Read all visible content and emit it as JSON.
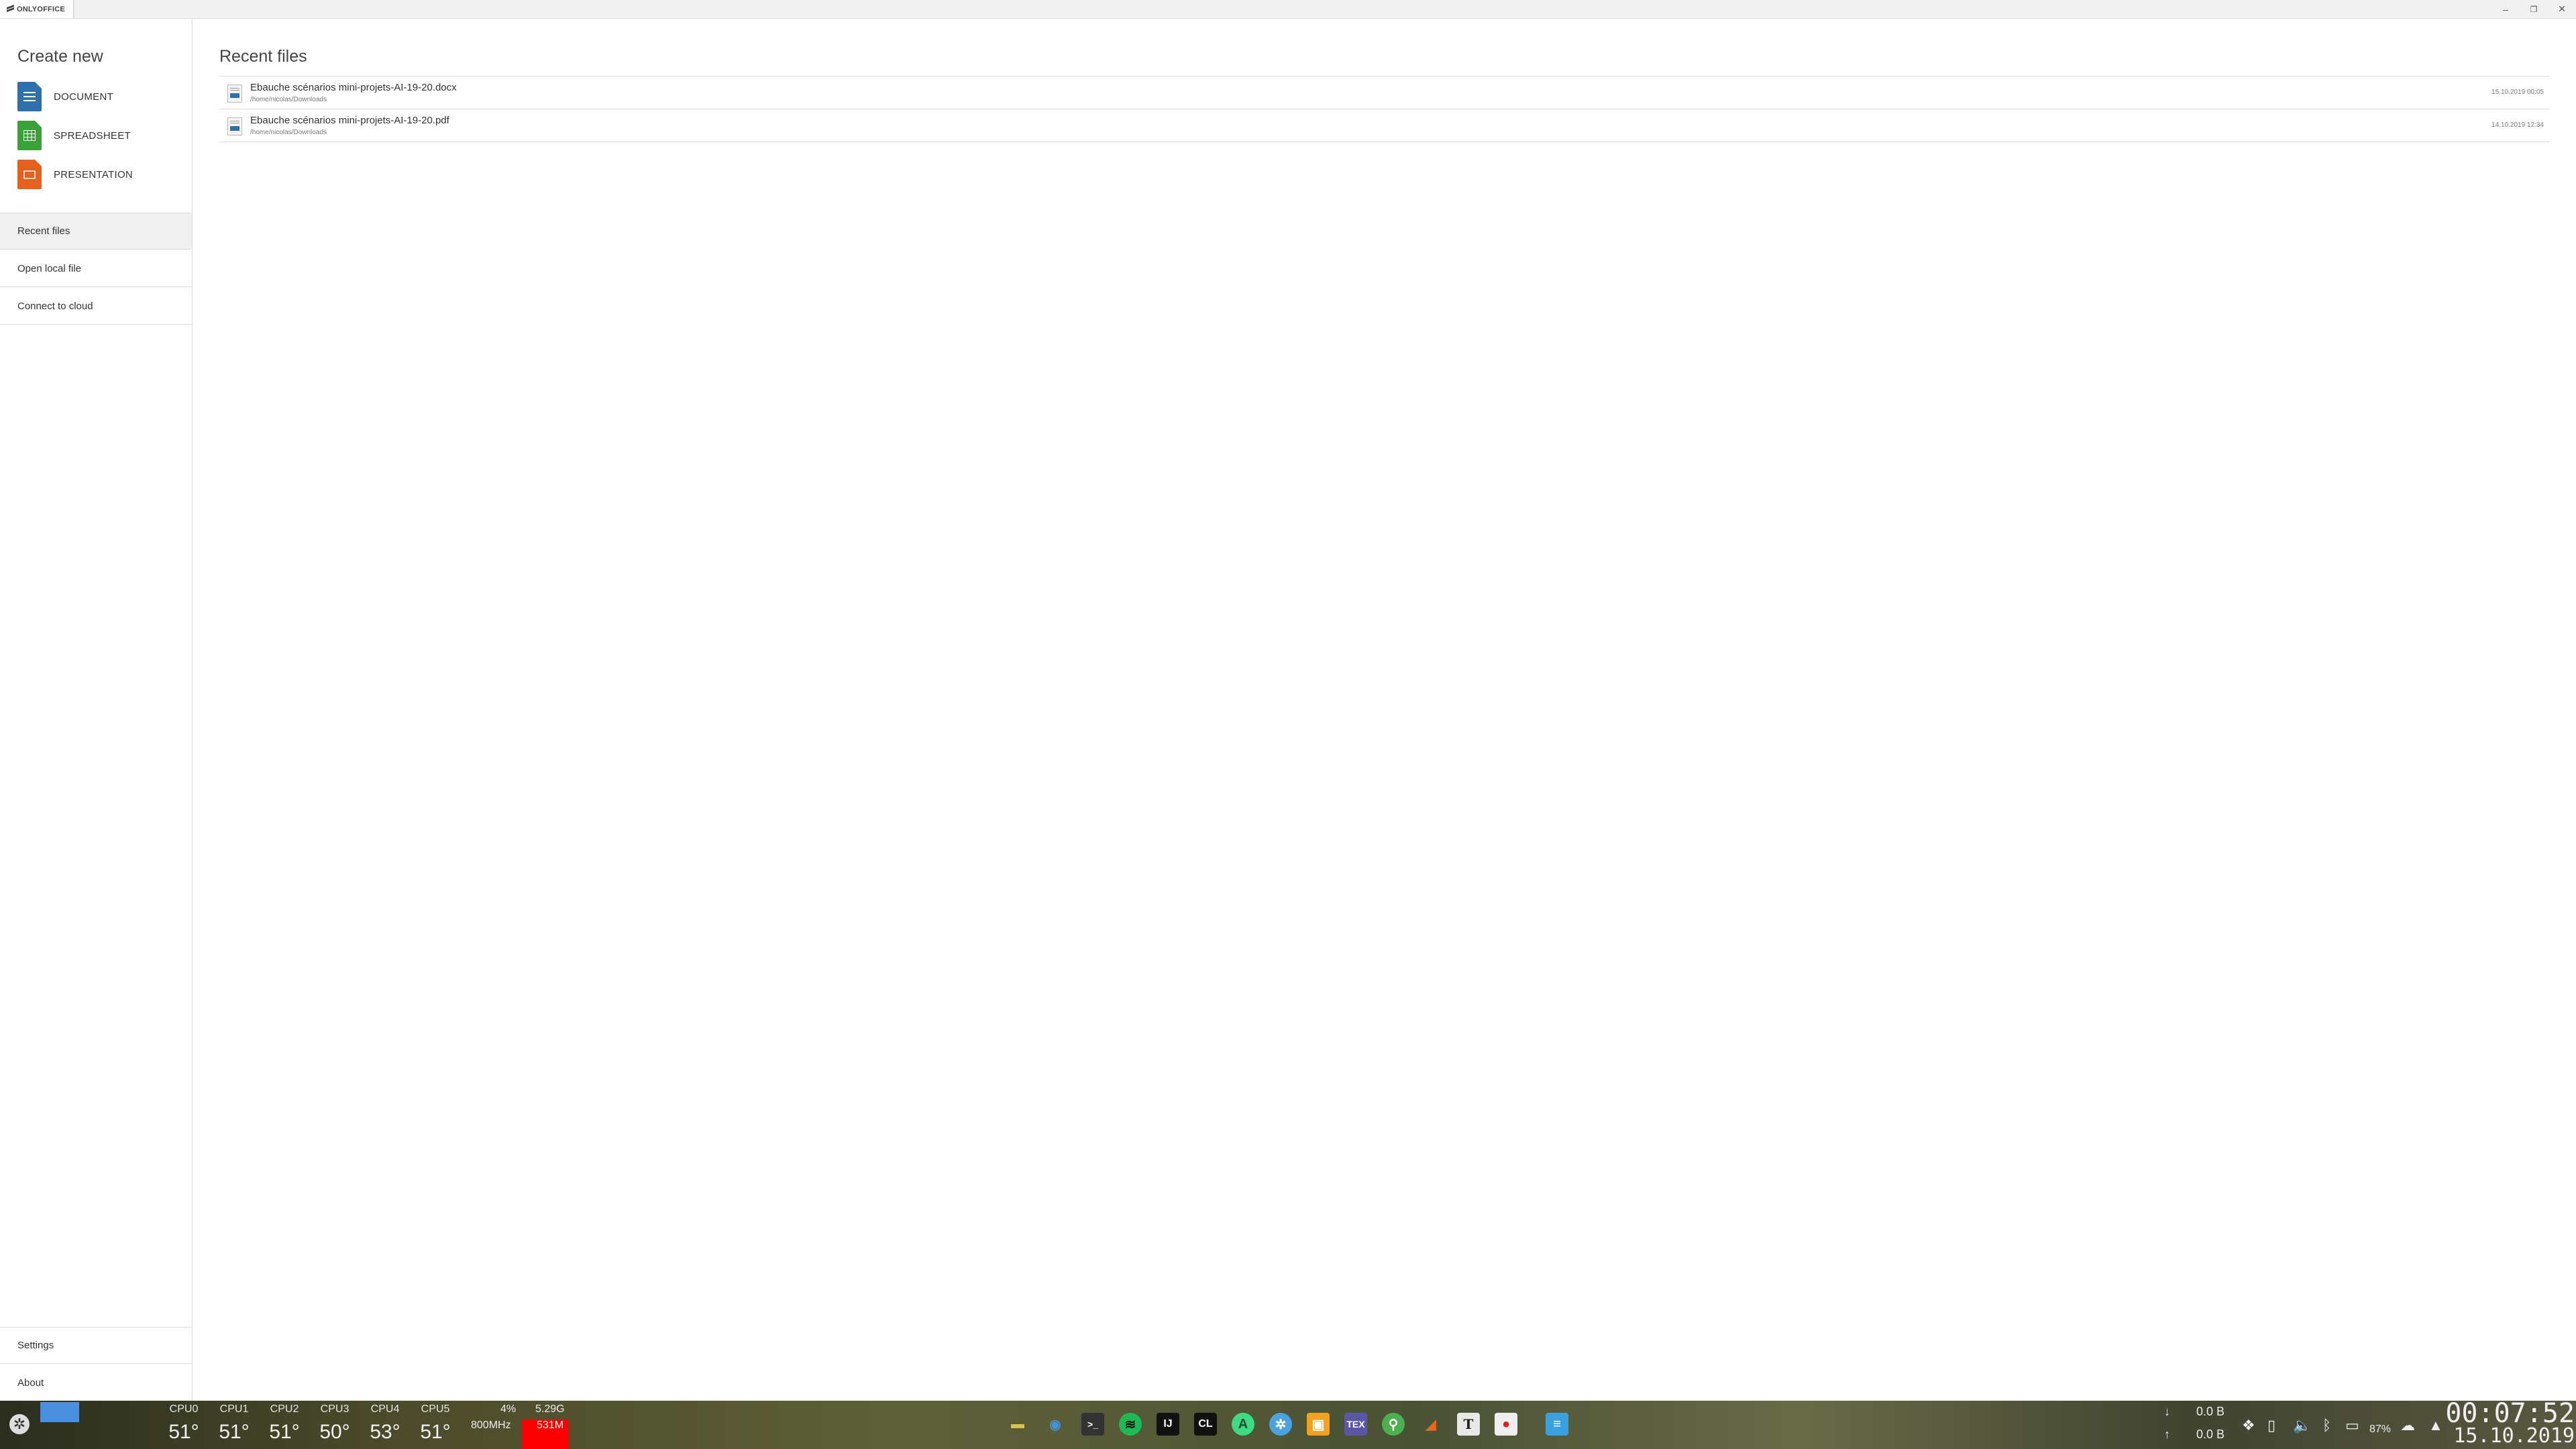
{
  "titlebar": {
    "app_name": "ONLYOFFICE",
    "minimize": "–",
    "restore": "❐",
    "close": "✕"
  },
  "sidebar": {
    "create_title": "Create new",
    "create_items": [
      {
        "label": "DOCUMENT",
        "color": "#2f6fae",
        "icon": "document-icon"
      },
      {
        "label": "SPREADSHEET",
        "color": "#3aa13a",
        "icon": "spreadsheet-icon"
      },
      {
        "label": "PRESENTATION",
        "color": "#e5611d",
        "icon": "presentation-icon"
      }
    ],
    "nav": [
      {
        "label": "Recent files",
        "active": true
      },
      {
        "label": "Open local file"
      },
      {
        "label": "Connect to cloud"
      }
    ],
    "bottom": [
      {
        "label": "Settings"
      },
      {
        "label": "About"
      }
    ]
  },
  "main": {
    "title": "Recent files",
    "files": [
      {
        "name": "Ebauche scénarios mini-projets-AI-19-20.docx",
        "path": "/home/nicolas/Downloads",
        "date": "15.10.2019 00:05"
      },
      {
        "name": "Ebauche scénarios mini-projets-AI-19-20.pdf",
        "path": "/home/nicolas/Downloads",
        "date": "14.10.2019 12:34"
      }
    ]
  },
  "taskbar": {
    "cpus": [
      {
        "name": "CPU0",
        "temp": "51°"
      },
      {
        "name": "CPU1",
        "temp": "51°"
      },
      {
        "name": "CPU2",
        "temp": "51°"
      },
      {
        "name": "CPU3",
        "temp": "50°"
      },
      {
        "name": "CPU4",
        "temp": "53°"
      },
      {
        "name": "CPU5",
        "temp": "51°"
      }
    ],
    "cpu_load": "4%",
    "cpu_freq": "800MHz",
    "mem_total": "5.29G",
    "mem_used": "531M",
    "apps": [
      {
        "icon": "file-manager-icon",
        "glyph": "▬",
        "color": "#d9c350"
      },
      {
        "icon": "chrome-icon",
        "glyph": "◉",
        "color": "#4a90d9"
      },
      {
        "icon": "terminal-icon",
        "glyph": ">_",
        "color": "#333333"
      },
      {
        "icon": "spotify-icon",
        "glyph": "≋",
        "color": "#1db954"
      },
      {
        "icon": "intellij-icon",
        "glyph": "IJ",
        "color": "#111111"
      },
      {
        "icon": "clion-icon",
        "glyph": "CL",
        "color": "#111111"
      },
      {
        "icon": "android-studio-icon",
        "glyph": "A",
        "color": "#3ddc84"
      },
      {
        "icon": "vpn-icon",
        "glyph": "✲",
        "color": "#4aa3df"
      },
      {
        "icon": "folder-app-icon",
        "glyph": "▣",
        "color": "#f4a020"
      },
      {
        "icon": "tex-icon",
        "glyph": "TEX",
        "color": "#5b56a6"
      },
      {
        "icon": "keepass-icon",
        "glyph": "⚲",
        "color": "#4caf50"
      },
      {
        "icon": "matlab-icon",
        "glyph": "◢",
        "color": "#e26a1f"
      },
      {
        "icon": "typora-icon",
        "glyph": "T",
        "color": "#e8e8e8"
      },
      {
        "icon": "recorder-icon",
        "glyph": "●",
        "color": "#eeeeee"
      },
      {
        "icon": "onlyoffice-icon",
        "glyph": "≡",
        "color": "#3aa0e0"
      }
    ],
    "net_down": "0.0 B",
    "net_up": "0.0 B",
    "battery": "87%",
    "time": "00:07:52",
    "date": "15.10.2019"
  }
}
